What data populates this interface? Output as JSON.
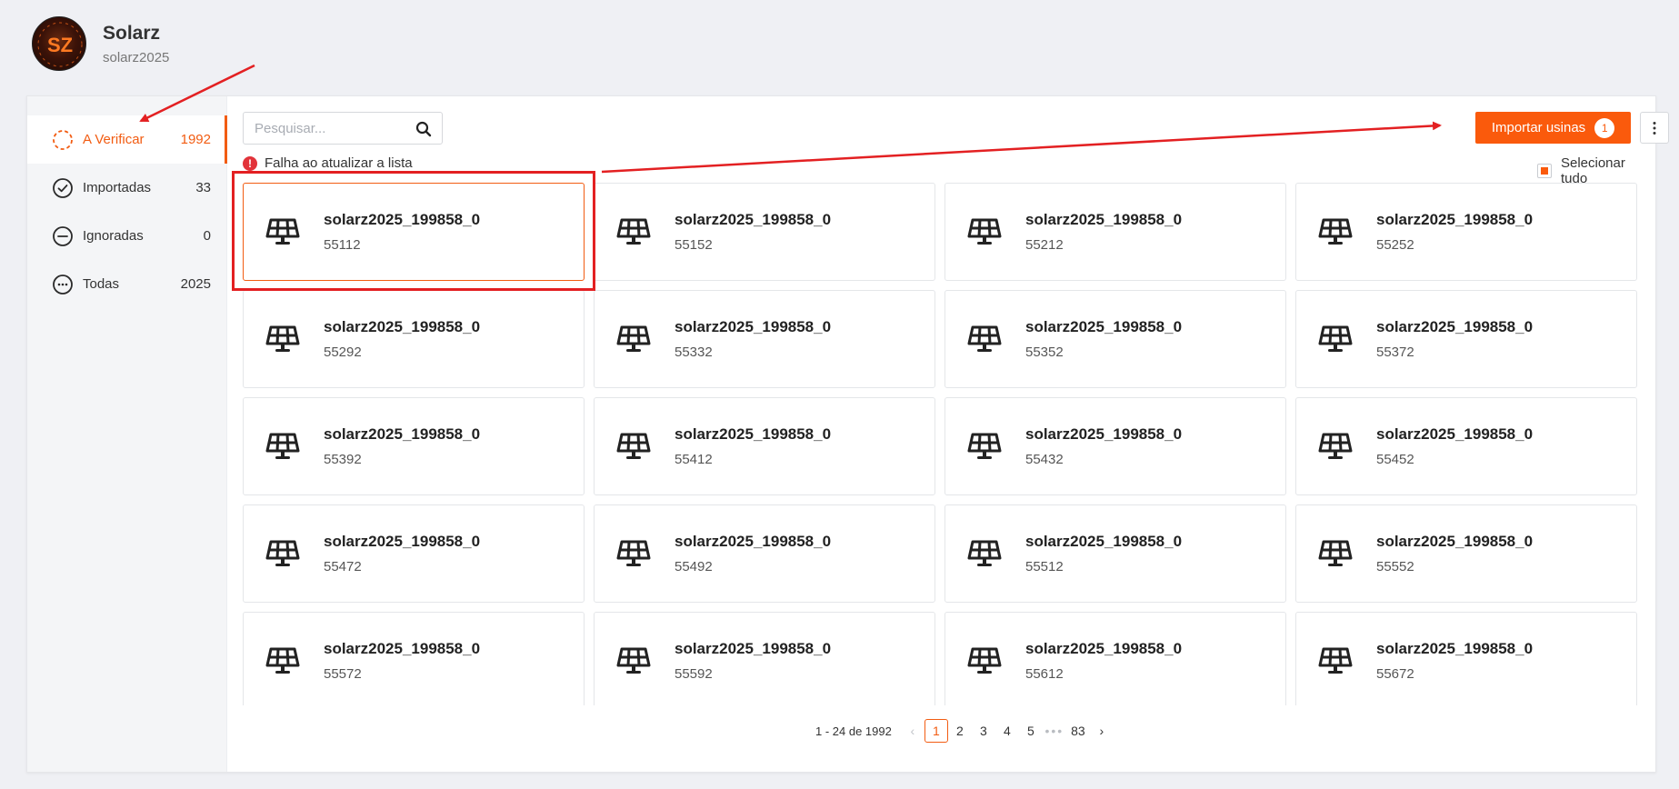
{
  "header": {
    "brand_name": "Solarz",
    "username": "solarz2025",
    "logo_text": "SZ"
  },
  "sidebar": {
    "items": [
      {
        "label": "A Verificar",
        "count": "1992",
        "icon": "dashed-circle-icon"
      },
      {
        "label": "Importadas",
        "count": "33",
        "icon": "check-circle-icon"
      },
      {
        "label": "Ignoradas",
        "count": "0",
        "icon": "minus-circle-icon"
      },
      {
        "label": "Todas",
        "count": "2025",
        "icon": "dots-circle-icon"
      }
    ]
  },
  "toolbar": {
    "search_placeholder": "Pesquisar...",
    "error_text": "Falha ao atualizar a lista",
    "error_icon": "!",
    "import_label": "Importar usinas",
    "import_badge": "1",
    "select_all_label": "Selecionar tudo"
  },
  "plants": [
    {
      "name": "solarz2025_199858_0",
      "id": "55112"
    },
    {
      "name": "solarz2025_199858_0",
      "id": "55152"
    },
    {
      "name": "solarz2025_199858_0",
      "id": "55212"
    },
    {
      "name": "solarz2025_199858_0",
      "id": "55252"
    },
    {
      "name": "solarz2025_199858_0",
      "id": "55292"
    },
    {
      "name": "solarz2025_199858_0",
      "id": "55332"
    },
    {
      "name": "solarz2025_199858_0",
      "id": "55352"
    },
    {
      "name": "solarz2025_199858_0",
      "id": "55372"
    },
    {
      "name": "solarz2025_199858_0",
      "id": "55392"
    },
    {
      "name": "solarz2025_199858_0",
      "id": "55412"
    },
    {
      "name": "solarz2025_199858_0",
      "id": "55432"
    },
    {
      "name": "solarz2025_199858_0",
      "id": "55452"
    },
    {
      "name": "solarz2025_199858_0",
      "id": "55472"
    },
    {
      "name": "solarz2025_199858_0",
      "id": "55492"
    },
    {
      "name": "solarz2025_199858_0",
      "id": "55512"
    },
    {
      "name": "solarz2025_199858_0",
      "id": "55552"
    },
    {
      "name": "solarz2025_199858_0",
      "id": "55572"
    },
    {
      "name": "solarz2025_199858_0",
      "id": "55592"
    },
    {
      "name": "solarz2025_199858_0",
      "id": "55612"
    },
    {
      "name": "solarz2025_199858_0",
      "id": "55672"
    }
  ],
  "pagination": {
    "total_text": "1 - 24 de 1992",
    "pages": [
      "1",
      "2",
      "3",
      "4",
      "5"
    ],
    "ellipsis": "•••",
    "last_page": "83",
    "prev": "‹",
    "next": "›"
  },
  "colors": {
    "accent": "#fa5a0c",
    "annotation": "#e32022",
    "error": "#e2333a"
  }
}
